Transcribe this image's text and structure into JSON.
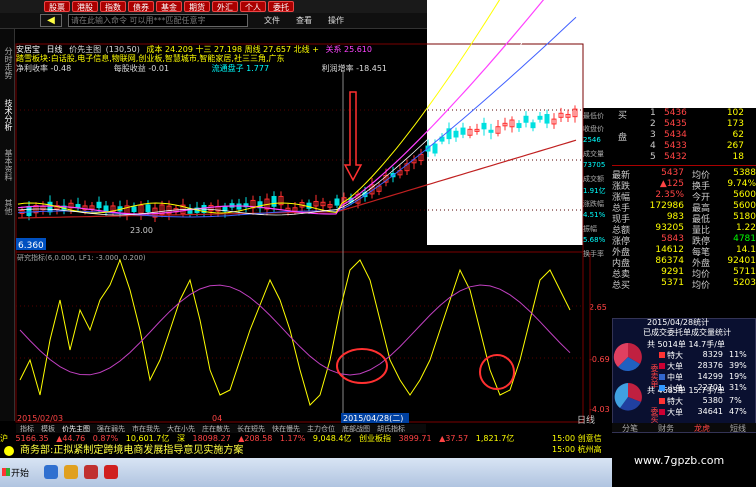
{
  "top_buttons": [
    "股票",
    "港股",
    "指数",
    "债券",
    "基金",
    "期货",
    "外汇",
    "个人",
    "委托"
  ],
  "search": {
    "placeholder": "请在此输入命令   可以用***匹配任意字"
  },
  "menus": [
    "文件",
    "查看",
    "操作"
  ],
  "left_tabs": [
    "分时走势",
    "技术分析",
    "基本资料",
    "其他"
  ],
  "header": {
    "line1_name": "安居宝",
    "line1_period": "日线",
    "line1_fq": "价先主图",
    "line1_vals": "(130,50)",
    "line1_rest": "成本 24.209  十三 27.198  周线 27.657  北线 +",
    "line1_tail": "关系 25.610",
    "line2": "踏雪板块:白话股,电子信息,物联网,创业板,智慧城市,智能家居,社三三角,广东",
    "line3_a": "净利收率 -0.48",
    "line3_b": "每股收益 -0.01",
    "line3_c": "流通盘子 1.777",
    "line3_d": "利润增率 -18.451"
  },
  "price_label": "6.360",
  "ma_label": "23.00",
  "indicator_header": "研究指标(6,0.000, LF1: -3.000, 0.200)",
  "x_axis": {
    "left": "2015/02/03",
    "mid": "04",
    "cursor": "2015/04/28(二)"
  },
  "right_axis": [
    "2.65",
    "-0.69",
    "-4.03"
  ],
  "right_axis_bottom": "日线",
  "left_info": [
    "最低价",
    "收盘价",
    "2546",
    "成交量",
    "73705",
    "成交额",
    "1.91亿",
    "涨跌幅",
    "4.51%",
    "振幅",
    "5.68%",
    "换手率"
  ],
  "order_book": [
    {
      "label": "买",
      "level": "1",
      "price": "5436",
      "vol": "102"
    },
    {
      "label": "",
      "level": "2",
      "price": "5435",
      "vol": "173"
    },
    {
      "label": "盘",
      "level": "3",
      "price": "5434",
      "vol": "62"
    },
    {
      "label": "",
      "level": "4",
      "price": "5433",
      "vol": "267"
    },
    {
      "label": "",
      "level": "5",
      "price": "5432",
      "vol": "18"
    }
  ],
  "quote": [
    {
      "l1": "最新",
      "v1": "5437",
      "l2": "均价",
      "v2": "5388"
    },
    {
      "l1": "涨跌",
      "v1": "▲125",
      "l2": "换手",
      "v2": "9.74%"
    },
    {
      "l1": "涨幅",
      "v1": "2.35%",
      "l2": "今开",
      "v2": "5600"
    },
    {
      "l1": "总手",
      "v1": "172986",
      "l2": "最高",
      "v2": "5600"
    },
    {
      "l1": "现手",
      "v1": "983",
      "l2": "最低",
      "v2": "5180"
    },
    {
      "l1": "总额",
      "v1": "93205",
      "l2": "量比",
      "v2": "1.22"
    },
    {
      "l1": "涨停",
      "v1": "5843",
      "l2": "跌停",
      "v2": "4781"
    },
    {
      "l1": "外盘",
      "v1": "14612",
      "l2": "每笔",
      "v2": "14.1"
    },
    {
      "l1": "内盘",
      "v1": "86374",
      "l2": "外盘",
      "v2": "92401"
    },
    {
      "l1": "总卖",
      "v1": "9291",
      "l2": "均价",
      "v2": "5711"
    },
    {
      "l1": "总买",
      "v1": "5371",
      "l2": "均价",
      "v2": "5203"
    }
  ],
  "statbox": {
    "title": "2015/04/28统计",
    "heading": "已成交委托单成交量统计",
    "sell_total": "共 5014单 14.7手/单",
    "buy_total": "共 4685单 15.7手/单",
    "sell_label": "委卖单",
    "buy_label": "委买",
    "sell_rows": [
      {
        "name": "特大",
        "a": "8329",
        "b": "11%"
      },
      {
        "name": "大单",
        "a": "28376",
        "b": "39%"
      },
      {
        "name": "中单",
        "a": "14299",
        "b": "19%"
      },
      {
        "name": "小单",
        "a": "22701",
        "b": "31%"
      }
    ],
    "buy_rows": [
      {
        "name": "特大",
        "a": "5380",
        "b": "7%"
      },
      {
        "name": "大单",
        "a": "34641",
        "b": "47%"
      }
    ]
  },
  "stat_tabs": [
    "分笔",
    "财务",
    "龙虎",
    "短线"
  ],
  "indicator_tabs": [
    "指标",
    "模板",
    "价先主图",
    "强在弱先",
    "市在我先",
    "大在小先",
    "庄在散先",
    "长在短先",
    "快在慢先",
    "主力仓位",
    "底部战图",
    "胡氏指标"
  ],
  "ticker": {
    "name": "沪",
    "index": "5166.35",
    "chg": "▲44.76",
    "pct": "0.87%",
    "amt": "10,601.7亿",
    "name2": "深",
    "index2": "18098.27",
    "chg2": "▲208.58",
    "pct2": "1.17%",
    "amt2": "9,048.4亿",
    "name3": "创业板指",
    "index3": "3899.71",
    "chg3": "▲37.57",
    "amt3": "1,821.7亿"
  },
  "news": "商务部:正拟紧制定跨境电商发展指导意见实施方案",
  "right_news": [
    "15:00 创意信",
    "15:00 杭州高"
  ],
  "start_label": "开始",
  "watermark": "www.7gpzb.com",
  "colors": {
    "up": "#ff3030",
    "down": "#00e0e0",
    "yellow": "#ffff00",
    "magenta": "#ff40ff",
    "white": "#ffffff",
    "blue": "#4060ff",
    "red_line": "#c02020"
  }
}
